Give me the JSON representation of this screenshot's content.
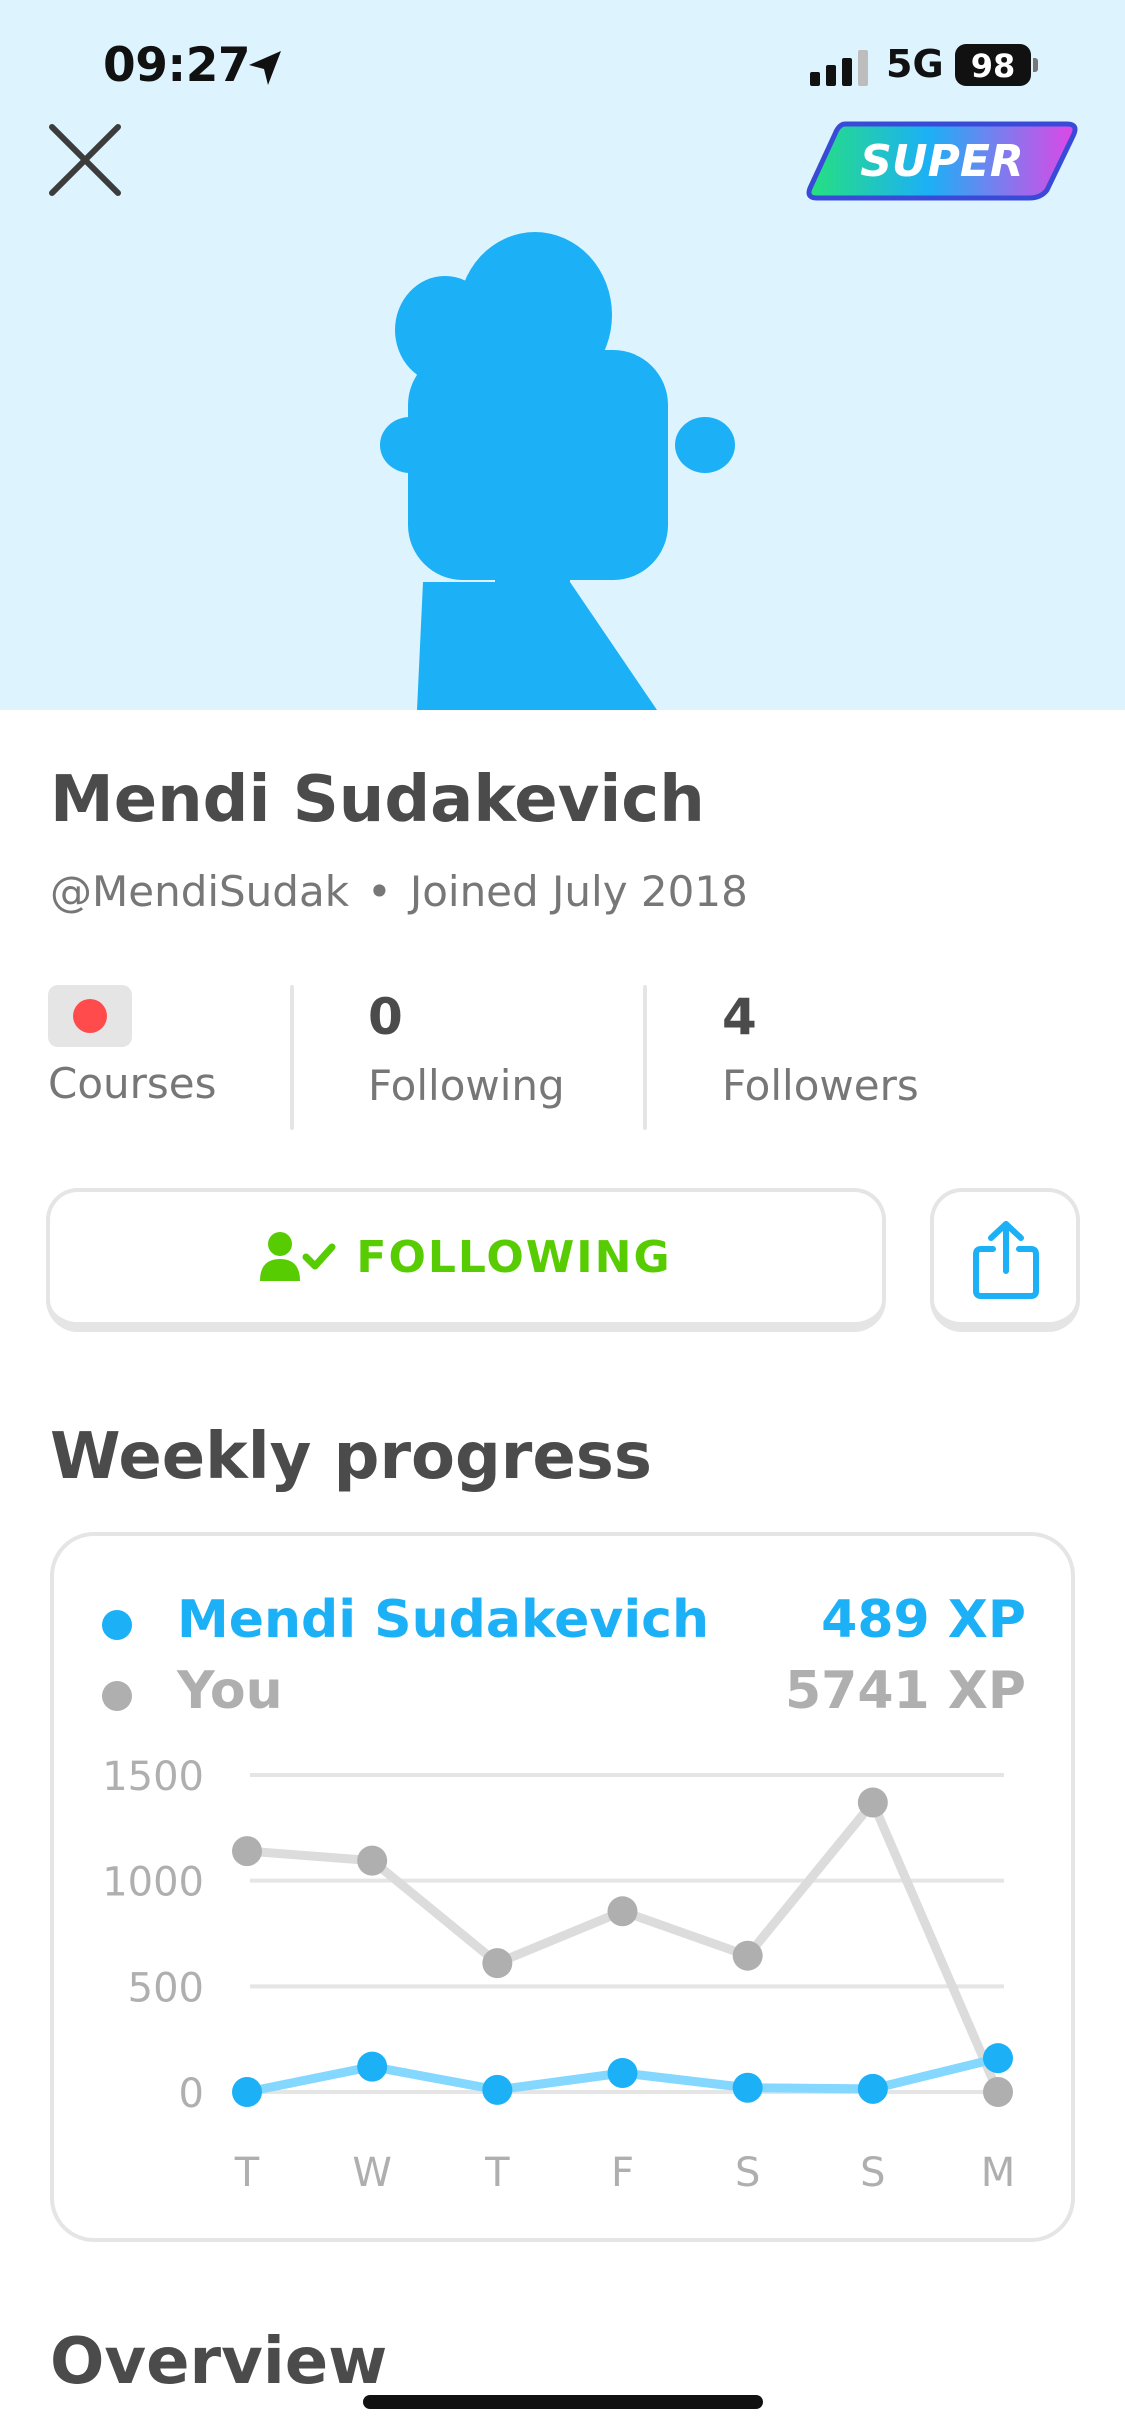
{
  "status_bar": {
    "time": "09:27",
    "network": "5G",
    "battery": "98"
  },
  "header": {
    "super_badge": "SUPER",
    "close_icon": "close-icon",
    "avatar_color": "#1cb0f6",
    "background_color": "#ddf4ff"
  },
  "profile": {
    "name": "Mendi Sudakevich",
    "username": "@MendiSudak",
    "joined": "Joined July 2018"
  },
  "stats": {
    "courses_label": "Courses",
    "course_flag": "japanese-flag-icon",
    "following_value": "0",
    "following_label": "Following",
    "followers_value": "4",
    "followers_label": "Followers"
  },
  "actions": {
    "follow_label": "FOLLOWING",
    "follow_color": "#58cc02",
    "share_color": "#1cb0f6"
  },
  "weekly_progress": {
    "title": "Weekly progress",
    "legend": [
      {
        "name": "Mendi Sudakevich",
        "xp": "489 XP",
        "color": "#1cb0f6"
      },
      {
        "name": "You",
        "xp": "5741 XP",
        "color": "#afafaf"
      }
    ]
  },
  "chart_data": {
    "type": "line",
    "categories": [
      "T",
      "W",
      "T",
      "F",
      "S",
      "S",
      "M"
    ],
    "series": [
      {
        "name": "Mendi Sudakevich",
        "values": [
          0,
          120,
          10,
          90,
          20,
          15,
          160
        ],
        "color": "#1cb0f6"
      },
      {
        "name": "You",
        "values": [
          1140,
          1095,
          610,
          855,
          645,
          1370,
          0
        ],
        "color": "#afafaf"
      }
    ],
    "ylim": [
      0,
      1500
    ],
    "yticks": [
      "1500",
      "1000",
      "500",
      "0"
    ],
    "grid": true
  },
  "overview": {
    "title": "Overview"
  }
}
